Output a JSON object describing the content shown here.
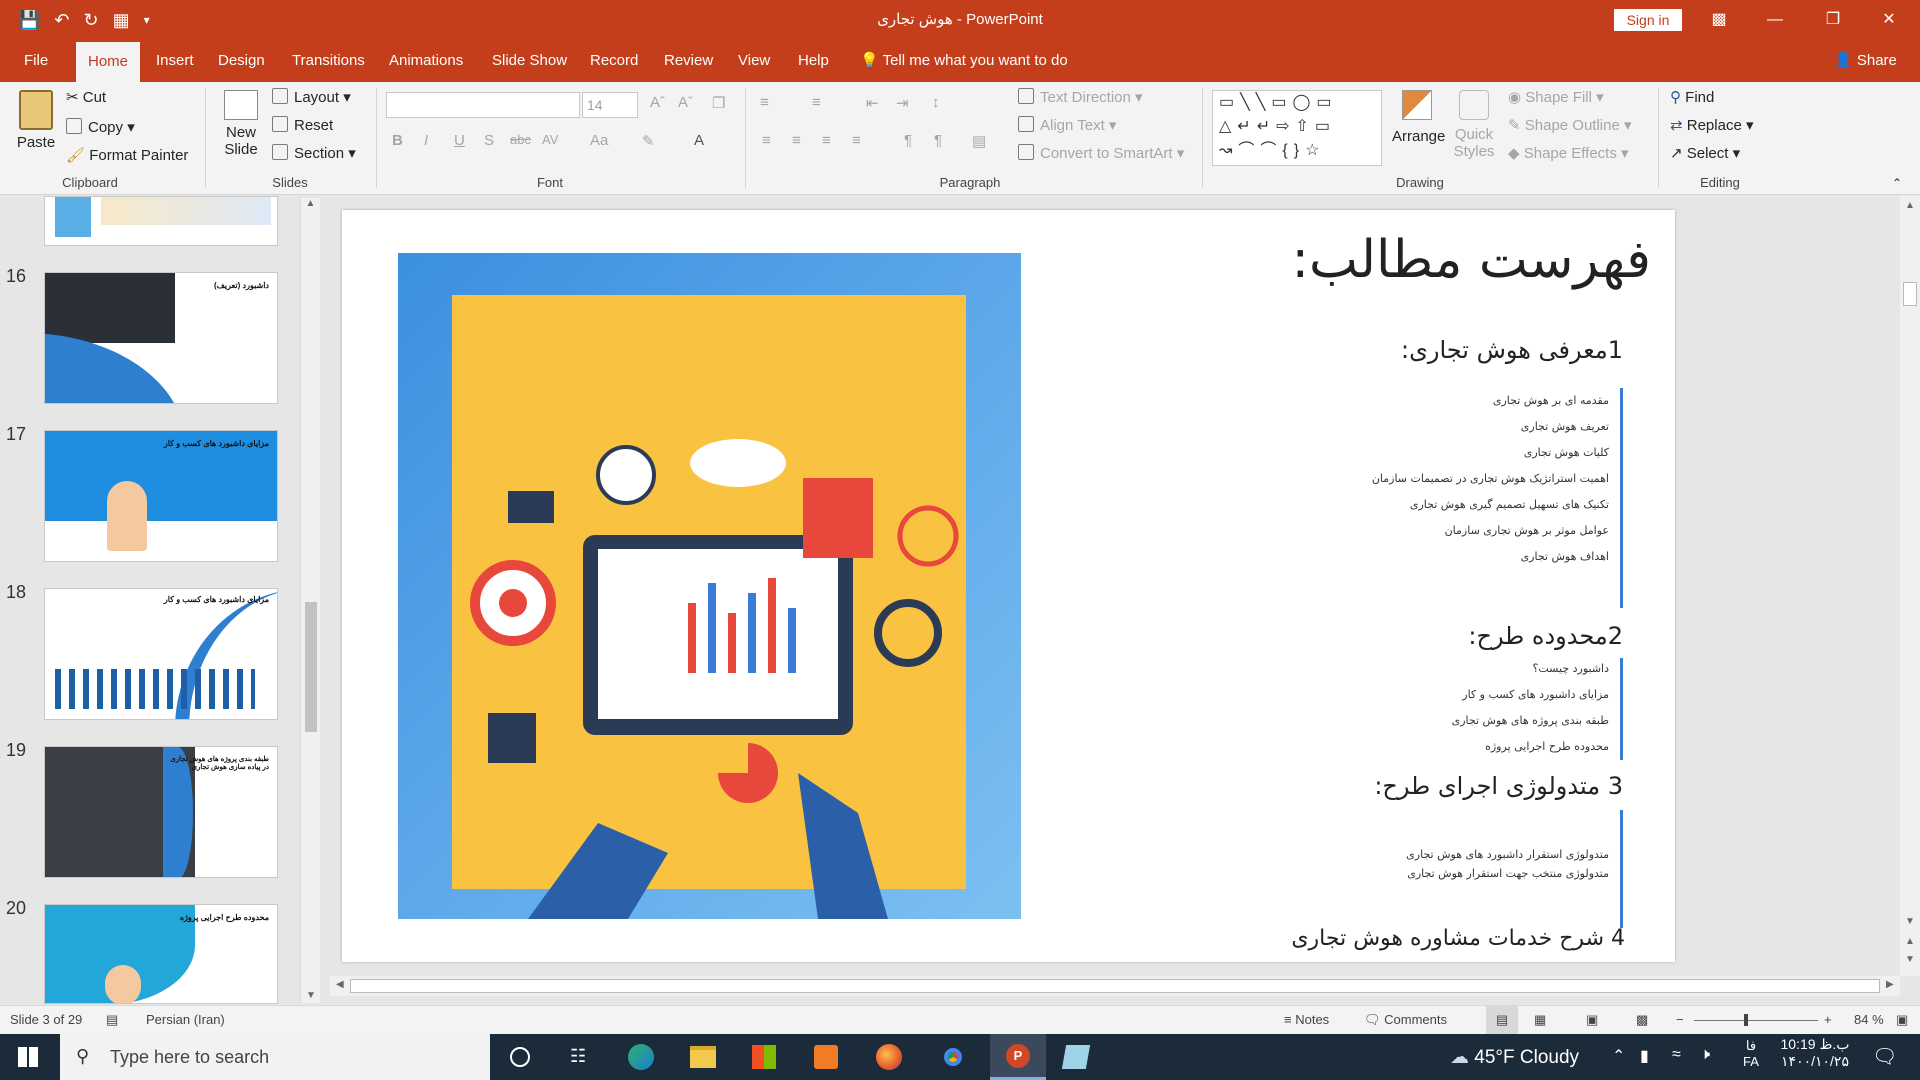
{
  "app": {
    "doc_title": "هوش تجاری",
    "app_name": "PowerPoint",
    "signin": "Sign in"
  },
  "tabs": [
    "File",
    "Home",
    "Insert",
    "Design",
    "Transitions",
    "Animations",
    "Slide Show",
    "Record",
    "Review",
    "View",
    "Help"
  ],
  "active_tab": "Home",
  "tell_me": "Tell me what you want to do",
  "share": "Share",
  "ribbon": {
    "clipboard": {
      "label": "Clipboard",
      "paste": "Paste",
      "cut": "Cut",
      "copy": "Copy",
      "format_painter": "Format Painter"
    },
    "slides": {
      "label": "Slides",
      "new_slide_1": "New",
      "new_slide_2": "Slide",
      "layout": "Layout",
      "reset": "Reset",
      "section": "Section"
    },
    "font": {
      "label": "Font",
      "font_name": "",
      "font_size": "14"
    },
    "paragraph": {
      "label": "Paragraph",
      "text_direction": "Text Direction",
      "align_text": "Align Text",
      "convert_smartart": "Convert to SmartArt"
    },
    "drawing": {
      "label": "Drawing",
      "arrange": "Arrange",
      "quick_styles_1": "Quick",
      "quick_styles_2": "Styles",
      "shape_fill": "Shape Fill",
      "shape_outline": "Shape Outline",
      "shape_effects": "Shape Effects"
    },
    "editing": {
      "label": "Editing",
      "find": "Find",
      "replace": "Replace",
      "select": "Select"
    }
  },
  "thumbnails": [
    {
      "num": "16",
      "title": "داشبورد (تعریف)"
    },
    {
      "num": "17",
      "title": "مزایای داشبورد های کسب و کار"
    },
    {
      "num": "18",
      "title": "مزایای داشبورد های کسب و کار"
    },
    {
      "num": "19",
      "title": "طبقه بندی پروژه های هوش تجاری در پیاده سازی هوش تجاری"
    },
    {
      "num": "20",
      "title": "محدوده طرح اجرایی پروژه"
    }
  ],
  "slide": {
    "title": "فهرست مطالب:",
    "sections": [
      {
        "heading": "1معرفی هوش تجاری:",
        "items": [
          "مقدمه ای بر هوش تجاری",
          "تعریف هوش تجاری",
          "کلیات هوش تجاری",
          "اهمیت استراتژیک هوش تجاری در تصمیمات سازمان",
          "تکنیک های تسهیل تصمیم گیری  هوش تجاری",
          "عوامل موثر بر هوش تجاری سازمان",
          "اهداف هوش تجاری"
        ]
      },
      {
        "heading": "2محدوده طرح:",
        "items": [
          "داشبورد چیست؟",
          "مزایای داشبورد های کسب و کار",
          "طبقه بندی پروژه های هوش تجاری",
          "محدوده طرح اجرایی پروژه"
        ]
      },
      {
        "heading": "3 متدولوژی اجرای طرح:",
        "items": [
          "متدولوژی استقرار داشبورد های هوش تجاری",
          "متدولوژی منتخب جهت استقرار هوش تجاری"
        ]
      },
      {
        "heading": "4 شرح خدمات مشاوره هوش تجاری",
        "items": []
      }
    ]
  },
  "status": {
    "slide_of": "Slide 3 of 29",
    "language": "Persian (Iran)",
    "notes": "Notes",
    "comments": "Comments",
    "zoom": "84 %"
  },
  "taskbar": {
    "search_placeholder": "Type here to search",
    "weather": "45°F  Cloudy",
    "lang": "FA",
    "lang2": "فا",
    "time": "10:19 ب.ظ",
    "date": "۱۴۰۰/۱۰/۲۵"
  },
  "colors": {
    "accent": "#c43e1c",
    "slide_blue": "#3a7bd5",
    "illustration_yellow": "#f9c240"
  }
}
